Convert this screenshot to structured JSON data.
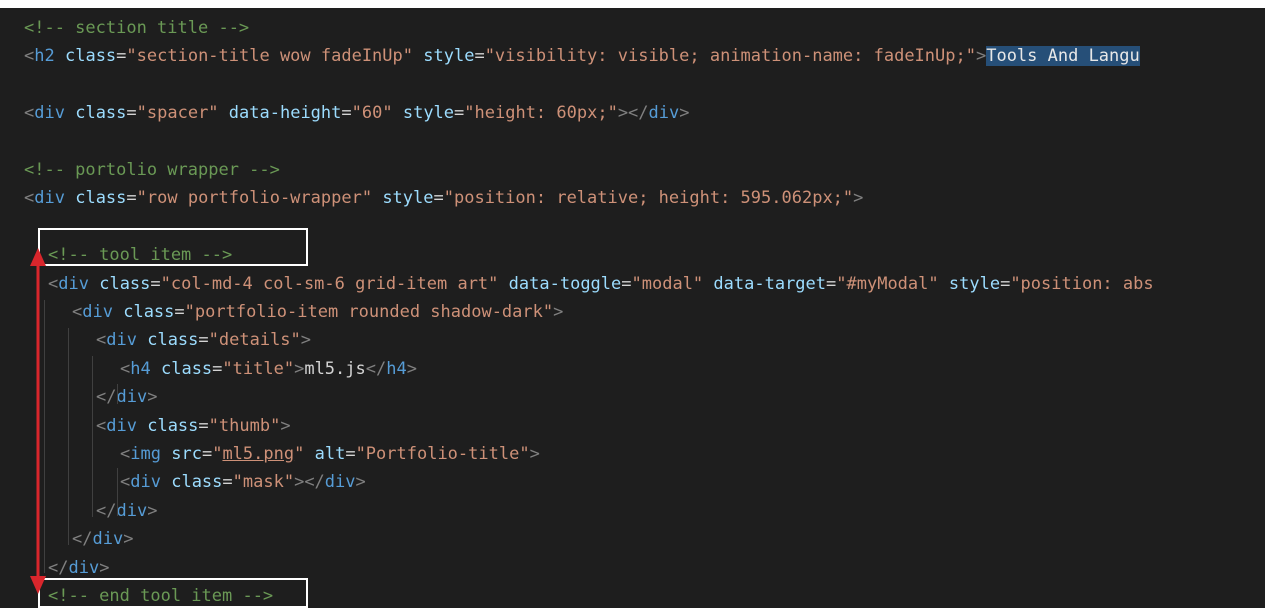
{
  "editor": {
    "lines": [
      {
        "indent": 0,
        "tokens": [
          {
            "t": "c",
            "v": "<!-- section title -->"
          }
        ]
      },
      {
        "indent": 0,
        "tokens": [
          {
            "t": "p",
            "v": "<"
          },
          {
            "t": "g",
            "v": "h2"
          },
          {
            "t": "x",
            "v": " "
          },
          {
            "t": "a",
            "v": "class"
          },
          {
            "t": "x",
            "v": "="
          },
          {
            "t": "s",
            "v": "\"section-title wow fadeInUp\""
          },
          {
            "t": "x",
            "v": " "
          },
          {
            "t": "a",
            "v": "style"
          },
          {
            "t": "x",
            "v": "="
          },
          {
            "t": "s",
            "v": "\"visibility: visible; animation-name: fadeInUp;\""
          },
          {
            "t": "p",
            "v": ">"
          },
          {
            "t": "sel",
            "v": "Tools And Langu"
          }
        ]
      },
      {
        "indent": 0,
        "tokens": []
      },
      {
        "indent": 0,
        "tokens": [
          {
            "t": "p",
            "v": "<"
          },
          {
            "t": "g",
            "v": "div"
          },
          {
            "t": "x",
            "v": " "
          },
          {
            "t": "a",
            "v": "class"
          },
          {
            "t": "x",
            "v": "="
          },
          {
            "t": "s",
            "v": "\"spacer\""
          },
          {
            "t": "x",
            "v": " "
          },
          {
            "t": "a",
            "v": "data-height"
          },
          {
            "t": "x",
            "v": "="
          },
          {
            "t": "s",
            "v": "\"60\""
          },
          {
            "t": "x",
            "v": " "
          },
          {
            "t": "a",
            "v": "style"
          },
          {
            "t": "x",
            "v": "="
          },
          {
            "t": "s",
            "v": "\"height: 60px;\""
          },
          {
            "t": "p",
            "v": "></"
          },
          {
            "t": "g",
            "v": "div"
          },
          {
            "t": "p",
            "v": ">"
          }
        ]
      },
      {
        "indent": 0,
        "tokens": []
      },
      {
        "indent": 0,
        "tokens": [
          {
            "t": "c",
            "v": "<!-- portolio wrapper -->"
          }
        ]
      },
      {
        "indent": 0,
        "tokens": [
          {
            "t": "p",
            "v": "<"
          },
          {
            "t": "g",
            "v": "div"
          },
          {
            "t": "x",
            "v": " "
          },
          {
            "t": "a",
            "v": "class"
          },
          {
            "t": "x",
            "v": "="
          },
          {
            "t": "s",
            "v": "\"row portfolio-wrapper\""
          },
          {
            "t": "x",
            "v": " "
          },
          {
            "t": "a",
            "v": "style"
          },
          {
            "t": "x",
            "v": "="
          },
          {
            "t": "s",
            "v": "\"position: relative; height: 595.062px;\""
          },
          {
            "t": "p",
            "v": ">"
          }
        ]
      },
      {
        "indent": 0,
        "tokens": []
      },
      {
        "indent": 1,
        "tokens": [
          {
            "t": "c",
            "v": "<!-- tool item -->"
          }
        ]
      },
      {
        "indent": 1,
        "tokens": [
          {
            "t": "p",
            "v": "<"
          },
          {
            "t": "g",
            "v": "div"
          },
          {
            "t": "x",
            "v": " "
          },
          {
            "t": "a",
            "v": "class"
          },
          {
            "t": "x",
            "v": "="
          },
          {
            "t": "s",
            "v": "\"col-md-4 col-sm-6 grid-item art\""
          },
          {
            "t": "x",
            "v": " "
          },
          {
            "t": "a",
            "v": "data-toggle"
          },
          {
            "t": "x",
            "v": "="
          },
          {
            "t": "s",
            "v": "\"modal\""
          },
          {
            "t": "x",
            "v": " "
          },
          {
            "t": "a",
            "v": "data-target"
          },
          {
            "t": "x",
            "v": "="
          },
          {
            "t": "s",
            "v": "\"#myModal\""
          },
          {
            "t": "x",
            "v": " "
          },
          {
            "t": "a",
            "v": "style"
          },
          {
            "t": "x",
            "v": "="
          },
          {
            "t": "s",
            "v": "\"position: abs"
          }
        ]
      },
      {
        "indent": 2,
        "tokens": [
          {
            "t": "p",
            "v": "<"
          },
          {
            "t": "g",
            "v": "div"
          },
          {
            "t": "x",
            "v": " "
          },
          {
            "t": "a",
            "v": "class"
          },
          {
            "t": "x",
            "v": "="
          },
          {
            "t": "s",
            "v": "\"portfolio-item rounded shadow-dark\""
          },
          {
            "t": "p",
            "v": ">"
          }
        ]
      },
      {
        "indent": 3,
        "tokens": [
          {
            "t": "p",
            "v": "<"
          },
          {
            "t": "g",
            "v": "div"
          },
          {
            "t": "x",
            "v": " "
          },
          {
            "t": "a",
            "v": "class"
          },
          {
            "t": "x",
            "v": "="
          },
          {
            "t": "s",
            "v": "\"details\""
          },
          {
            "t": "p",
            "v": ">"
          }
        ]
      },
      {
        "indent": 4,
        "tokens": [
          {
            "t": "p",
            "v": "<"
          },
          {
            "t": "g",
            "v": "h4"
          },
          {
            "t": "x",
            "v": " "
          },
          {
            "t": "a",
            "v": "class"
          },
          {
            "t": "x",
            "v": "="
          },
          {
            "t": "s",
            "v": "\"title\""
          },
          {
            "t": "p",
            "v": ">"
          },
          {
            "t": "x",
            "v": "ml5.js"
          },
          {
            "t": "p",
            "v": "</"
          },
          {
            "t": "g",
            "v": "h4"
          },
          {
            "t": "p",
            "v": ">"
          }
        ]
      },
      {
        "indent": 3,
        "tokens": [
          {
            "t": "p",
            "v": "</"
          },
          {
            "t": "g",
            "v": "div"
          },
          {
            "t": "p",
            "v": ">"
          }
        ]
      },
      {
        "indent": 3,
        "tokens": [
          {
            "t": "p",
            "v": "<"
          },
          {
            "t": "g",
            "v": "div"
          },
          {
            "t": "x",
            "v": " "
          },
          {
            "t": "a",
            "v": "class"
          },
          {
            "t": "x",
            "v": "="
          },
          {
            "t": "s",
            "v": "\"thumb\""
          },
          {
            "t": "p",
            "v": ">"
          }
        ]
      },
      {
        "indent": 4,
        "tokens": [
          {
            "t": "p",
            "v": "<"
          },
          {
            "t": "g",
            "v": "img"
          },
          {
            "t": "x",
            "v": " "
          },
          {
            "t": "a",
            "v": "src"
          },
          {
            "t": "x",
            "v": "="
          },
          {
            "t": "s",
            "v": "\""
          },
          {
            "t": "su",
            "v": "ml5.png"
          },
          {
            "t": "s",
            "v": "\""
          },
          {
            "t": "x",
            "v": " "
          },
          {
            "t": "a",
            "v": "alt"
          },
          {
            "t": "x",
            "v": "="
          },
          {
            "t": "s",
            "v": "\"Portfolio-title\""
          },
          {
            "t": "p",
            "v": ">"
          }
        ]
      },
      {
        "indent": 4,
        "tokens": [
          {
            "t": "p",
            "v": "<"
          },
          {
            "t": "g",
            "v": "div"
          },
          {
            "t": "x",
            "v": " "
          },
          {
            "t": "a",
            "v": "class"
          },
          {
            "t": "x",
            "v": "="
          },
          {
            "t": "s",
            "v": "\"mask\""
          },
          {
            "t": "p",
            "v": "></"
          },
          {
            "t": "g",
            "v": "div"
          },
          {
            "t": "p",
            "v": ">"
          }
        ]
      },
      {
        "indent": 3,
        "tokens": [
          {
            "t": "p",
            "v": "</"
          },
          {
            "t": "g",
            "v": "div"
          },
          {
            "t": "p",
            "v": ">"
          }
        ]
      },
      {
        "indent": 2,
        "tokens": [
          {
            "t": "p",
            "v": "</"
          },
          {
            "t": "g",
            "v": "div"
          },
          {
            "t": "p",
            "v": ">"
          }
        ]
      },
      {
        "indent": 1,
        "tokens": [
          {
            "t": "p",
            "v": "</"
          },
          {
            "t": "g",
            "v": "div"
          },
          {
            "t": "p",
            "v": ">"
          }
        ]
      },
      {
        "indent": 1,
        "tokens": [
          {
            "t": "c",
            "v": "<!-- end tool item -->"
          }
        ]
      }
    ]
  },
  "annotation": {
    "arrow_color": "#d9262c",
    "box_color": "#ffffff"
  },
  "colors": {
    "background": "#1e1e1e",
    "comment": "#6a9955",
    "tag": "#569cd6",
    "attribute": "#9cdcfe",
    "string": "#ce9178",
    "text": "#d4d4d4",
    "selection": "#264f78"
  }
}
